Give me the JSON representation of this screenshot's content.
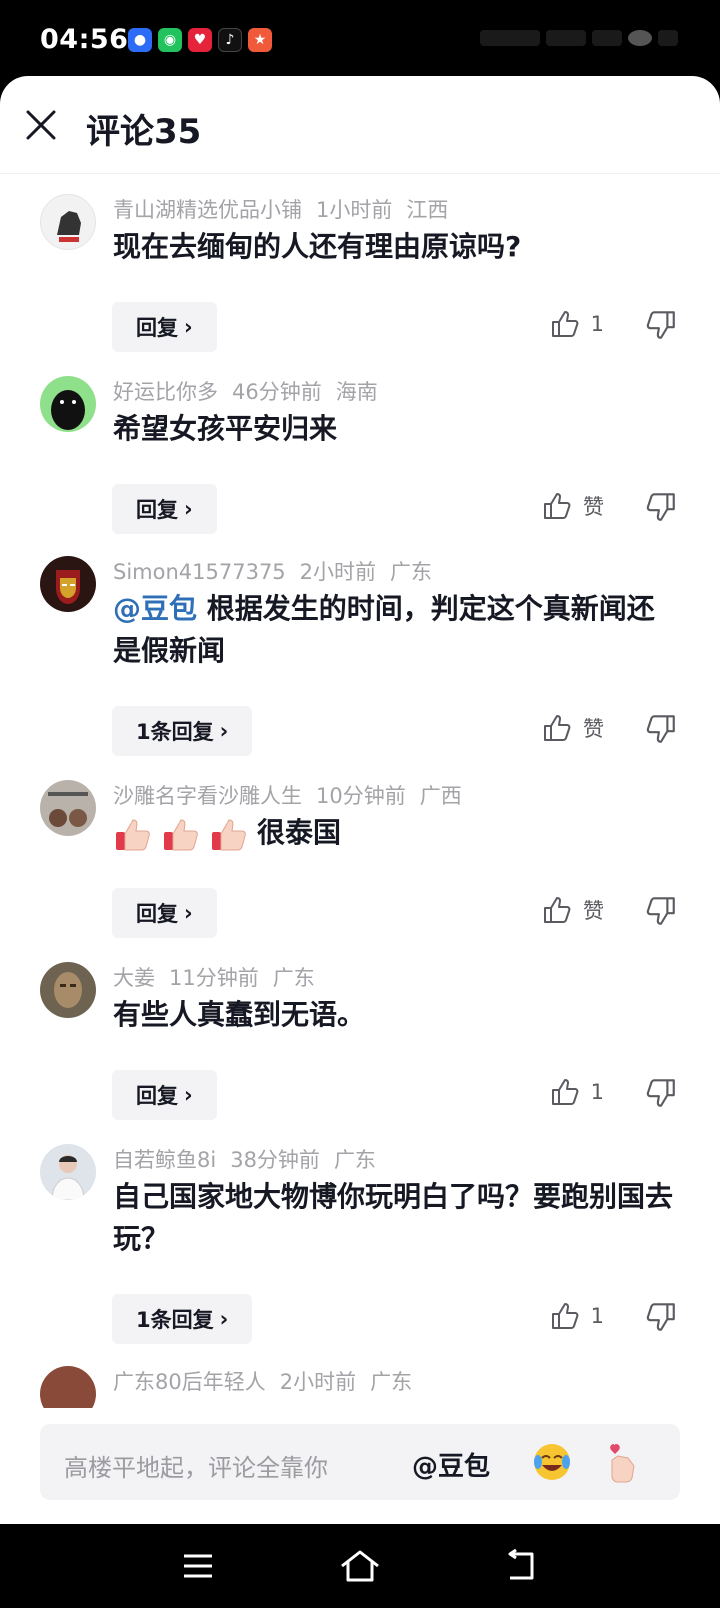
{
  "status_bar": {
    "time": "04:56",
    "app_icons": [
      "baidu-icon",
      "wechat-icon",
      "redbook-icon",
      "tiktok-icon",
      "game-icon"
    ]
  },
  "header": {
    "title": "评论35"
  },
  "comments": [
    {
      "username": "青山湖精选优品小铺",
      "time": "1小时前",
      "location": "江西",
      "text": "现在去缅甸的人还有理由原谅吗?",
      "reply_label": "回复",
      "like_label": "1"
    },
    {
      "username": "好运比你多",
      "time": "46分钟前",
      "location": "海南",
      "text": "希望女孩平安归来",
      "reply_label": "回复",
      "like_label": "赞"
    },
    {
      "username": "Simon41577375",
      "time": "2小时前",
      "location": "广东",
      "mention": "@豆包",
      "text": " 根据发生的时间，判定这个真新闻还是假新闻",
      "reply_label": "1条回复",
      "like_label": "赞"
    },
    {
      "username": "沙雕名字看沙雕人生",
      "time": "10分钟前",
      "location": "广西",
      "emoji_name": "thumbs-up-emoji",
      "text": "很泰国",
      "reply_label": "回复",
      "like_label": "赞"
    },
    {
      "username": "大姜",
      "time": "11分钟前",
      "location": "广东",
      "text": "有些人真蠢到无语。",
      "reply_label": "回复",
      "like_label": "1"
    },
    {
      "username": "自若鲸鱼8i",
      "time": "38分钟前",
      "location": "广东",
      "text": "自己国家地大物博你玩明白了吗？要跑别国去玩？",
      "reply_label": "1条回复",
      "like_label": "1"
    },
    {
      "username": "广东80后年轻人",
      "time": "2小时前",
      "location": "广东"
    }
  ],
  "input_bar": {
    "placeholder": "高楼平地起，评论全靠你",
    "mention_label": "@豆包",
    "emojis": [
      "laughing-crying-emoji",
      "finger-heart-emoji"
    ]
  },
  "navbar": {
    "icons": [
      "menu-icon",
      "home-icon",
      "back-icon"
    ]
  },
  "colors": {
    "mention": "#2f6fb7",
    "meta_text": "#a3a3a8",
    "reply_bg": "#f3f3f5"
  }
}
